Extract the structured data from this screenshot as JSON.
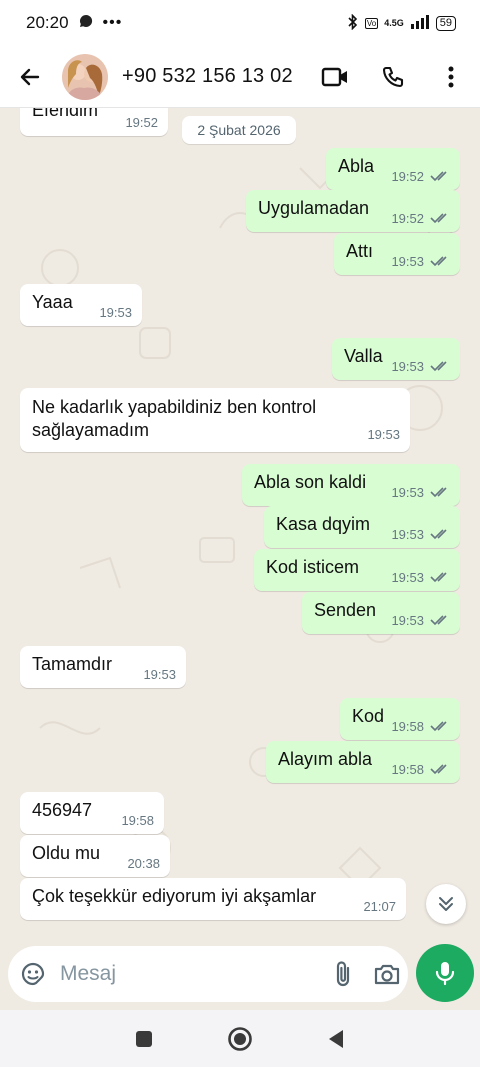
{
  "status": {
    "time": "20:20",
    "network": "4.5G",
    "battery": "59"
  },
  "header": {
    "contact_name": "+90 532 156 13 02"
  },
  "chat": {
    "date_divider": "2 Şubat 2026",
    "messages": [
      {
        "dir": "in",
        "text": "Efendim",
        "time": "19:52"
      },
      {
        "dir": "out",
        "text": "Abla",
        "time": "19:52"
      },
      {
        "dir": "out",
        "text": "Uygulamadan",
        "time": "19:52"
      },
      {
        "dir": "out",
        "text": "Attı",
        "time": "19:53"
      },
      {
        "dir": "in",
        "text": "Yaaa",
        "time": "19:53"
      },
      {
        "dir": "out",
        "text": "Valla",
        "time": "19:53"
      },
      {
        "dir": "in",
        "text": "Ne kadarlık yapabildiniz ben kontrol sağlayamadım",
        "time": "19:53"
      },
      {
        "dir": "out",
        "text": "Abla son kaldi",
        "time": "19:53"
      },
      {
        "dir": "out",
        "text": "Kasa dqyim",
        "time": "19:53"
      },
      {
        "dir": "out",
        "text": "Kod isticem",
        "time": "19:53"
      },
      {
        "dir": "out",
        "text": "Senden",
        "time": "19:53"
      },
      {
        "dir": "in",
        "text": "Tamamdır",
        "time": "19:53"
      },
      {
        "dir": "out",
        "text": "Kod",
        "time": "19:58"
      },
      {
        "dir": "out",
        "text": "Alayım abla",
        "time": "19:58"
      },
      {
        "dir": "in",
        "text": "456947",
        "time": "19:58"
      },
      {
        "dir": "in",
        "text": "Oldu mu",
        "time": "20:38"
      },
      {
        "dir": "in",
        "text": "Çok teşekkür ediyorum iyi akşamlar",
        "time": "21:07"
      }
    ]
  },
  "composer": {
    "placeholder": "Mesaj"
  },
  "icons": {
    "back": "arrow-left-icon",
    "video": "video-call-icon",
    "call": "phone-icon",
    "more": "more-vertical-icon",
    "emoji": "emoji-sticker-icon",
    "attach": "paperclip-icon",
    "camera": "camera-icon",
    "mic": "microphone-icon",
    "scroll": "double-chevron-down-icon",
    "read": "double-check-icon"
  },
  "colors": {
    "outgoing_bubble": "#d9fdd3",
    "incoming_bubble": "#ffffff",
    "accent": "#1daa61",
    "chat_bg": "#efeae2"
  }
}
